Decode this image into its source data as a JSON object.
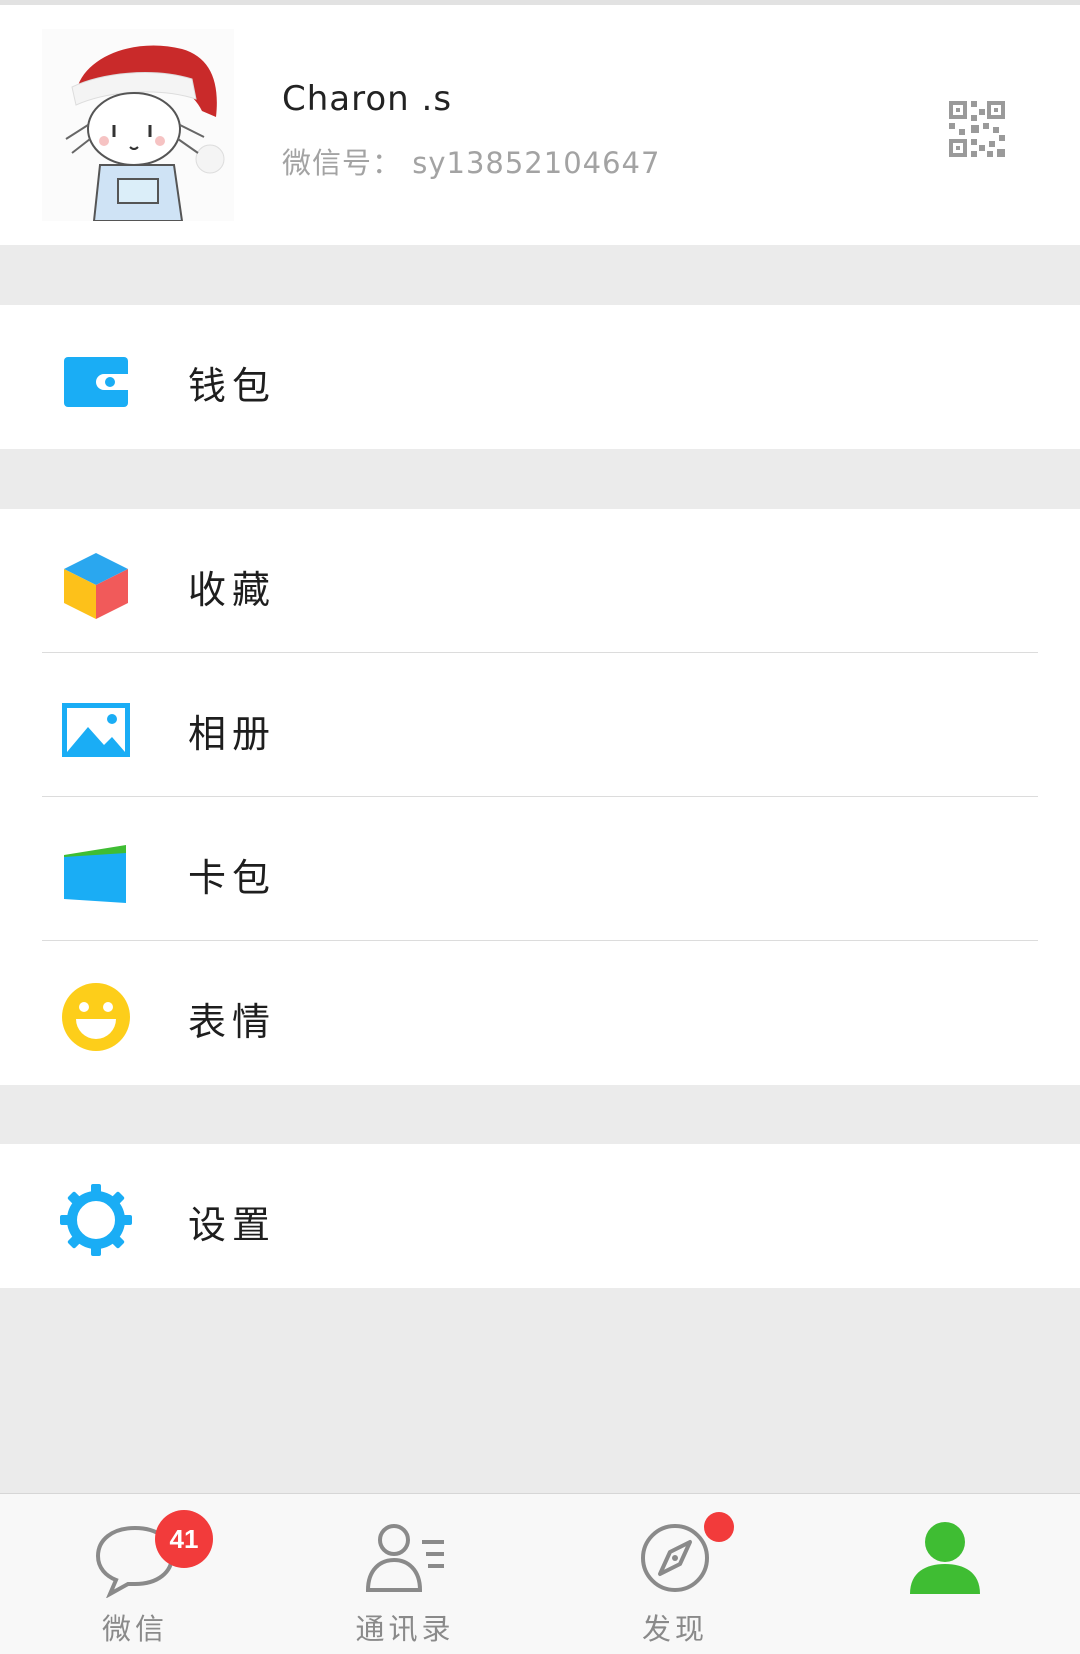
{
  "profile": {
    "name": "Charon .s",
    "wechat_id": "微信号：  sy13852104647"
  },
  "menu": {
    "wallet": "钱包",
    "favorites": "收藏",
    "album": "相册",
    "cards": "卡包",
    "stickers": "表情",
    "settings": "设置"
  },
  "tabs": [
    {
      "label": "微信",
      "icon": "chat-bubble-icon",
      "badge": "41"
    },
    {
      "label": "通讯录",
      "icon": "contacts-icon"
    },
    {
      "label": "发现",
      "icon": "compass-icon",
      "dot": true
    },
    {
      "label": "",
      "icon": "me-person-icon",
      "active": true
    }
  ],
  "colors": {
    "accent_blue": "#1aadf5",
    "active_green": "#3fbd33",
    "badge_red": "#f23b3b",
    "smile_yellow": "#fdce1a"
  }
}
